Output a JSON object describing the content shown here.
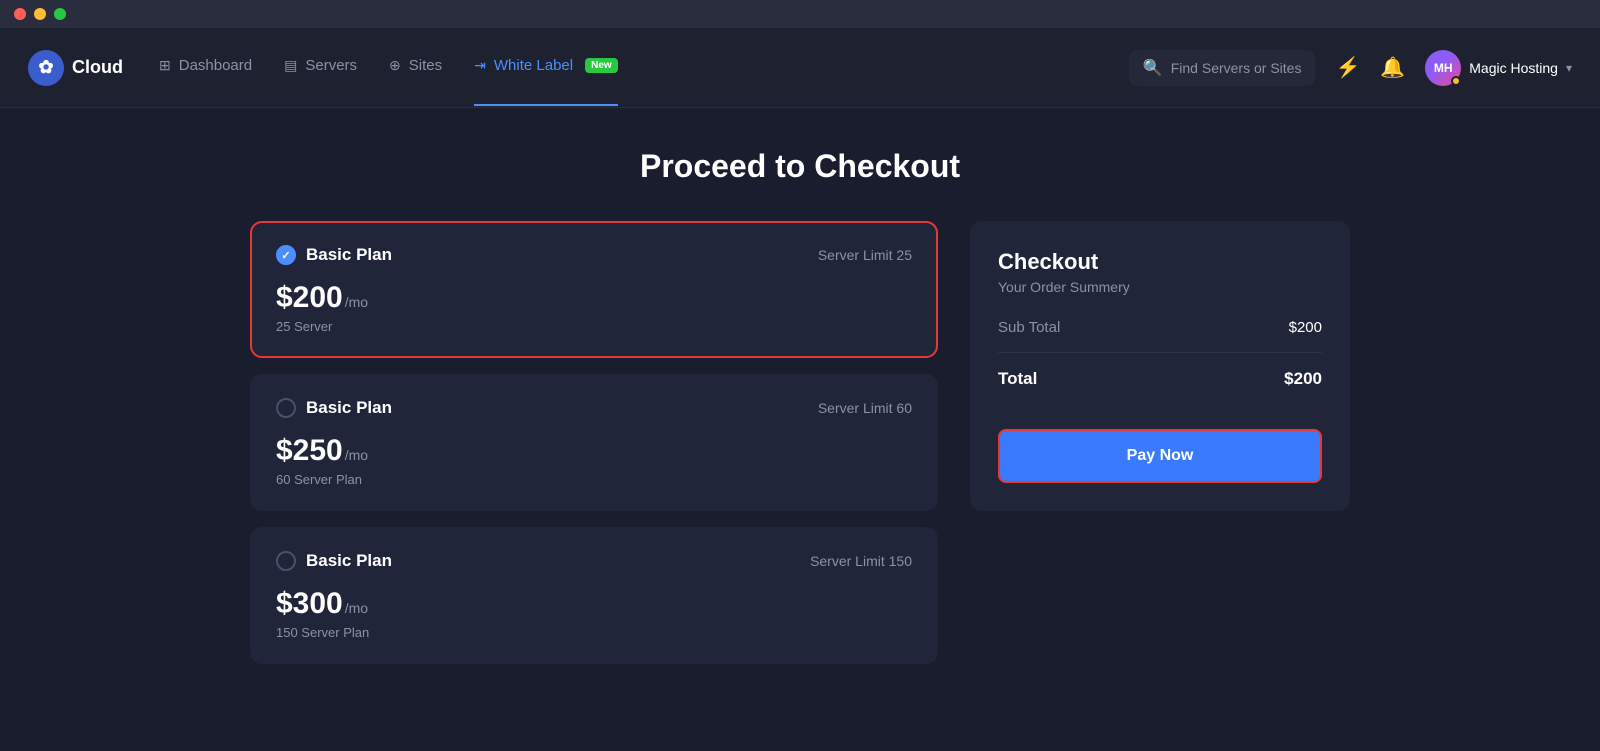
{
  "window": {
    "traffic": [
      "close",
      "minimize",
      "maximize"
    ]
  },
  "navbar": {
    "logo_text": "Cloud",
    "nav_items": [
      {
        "id": "dashboard",
        "label": "Dashboard",
        "icon": "⊞",
        "active": false
      },
      {
        "id": "servers",
        "label": "Servers",
        "icon": "▤",
        "active": false
      },
      {
        "id": "sites",
        "label": "Sites",
        "icon": "⊕",
        "active": false
      },
      {
        "id": "whitelabel",
        "label": "White Label",
        "icon": "⇥",
        "badge": "New",
        "active": true
      }
    ],
    "search_placeholder": "Find Servers or Sites",
    "user_initials": "MH",
    "user_name": "Magic Hosting",
    "chevron": "▾"
  },
  "page": {
    "title": "Proceed to Checkout"
  },
  "plans": [
    {
      "id": "plan-basic-25",
      "name": "Basic Plan",
      "limit": "Server Limit 25",
      "price": "$200",
      "period": "/mo",
      "description": "25 Server",
      "selected": true
    },
    {
      "id": "plan-basic-60",
      "name": "Basic Plan",
      "limit": "Server Limit 60",
      "price": "$250",
      "period": "/mo",
      "description": "60 Server Plan",
      "selected": false
    },
    {
      "id": "plan-basic-150",
      "name": "Basic Plan",
      "limit": "Server Limit 150",
      "price": "$300",
      "period": "/mo",
      "description": "150 Server Plan",
      "selected": false
    }
  ],
  "checkout": {
    "title": "Checkout",
    "subtitle": "Your Order Summery",
    "subtotal_label": "Sub Total",
    "subtotal_value": "$200",
    "total_label": "Total",
    "total_value": "$200",
    "pay_button_label": "Pay Now"
  }
}
